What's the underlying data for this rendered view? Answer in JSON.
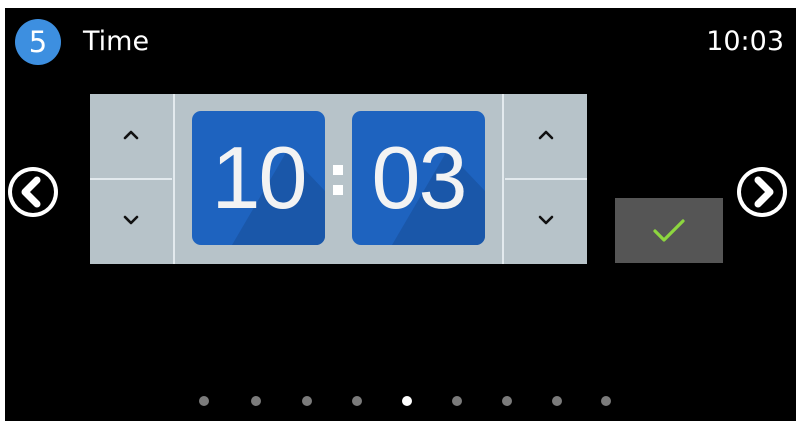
{
  "header": {
    "step_number": "5",
    "title": "Time",
    "clock": "10:03"
  },
  "time_picker": {
    "hours": "10",
    "minutes": "03",
    "separator": ":"
  },
  "icons": {
    "nav_prev": "chevron-left-circle-icon",
    "nav_next": "chevron-right-circle-icon",
    "increment": "caret-up-icon",
    "decrement": "caret-down-icon",
    "confirm": "checkmark-icon"
  },
  "pagination": {
    "total": 9,
    "active_index": 4
  },
  "colors": {
    "background": "#000000",
    "accent": "#3d8fe0",
    "digit_box": "#1e63bf",
    "picker_panel": "#b7c3c9",
    "confirm_button": "#555555",
    "checkmark": "#8dd63f",
    "dot_inactive": "#7b7b7b",
    "dot_active": "#ffffff"
  }
}
